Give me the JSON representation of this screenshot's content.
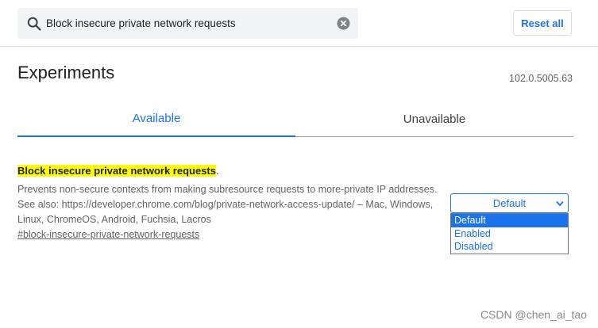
{
  "search": {
    "value": "Block insecure private network requests",
    "icon": "search-icon",
    "clear_icon": "clear-icon"
  },
  "header": {
    "reset_label": "Reset all"
  },
  "page": {
    "title": "Experiments",
    "version": "102.0.5005.63"
  },
  "tabs": [
    {
      "label": "Available",
      "active": true
    },
    {
      "label": "Unavailable",
      "active": false
    }
  ],
  "experiment": {
    "title_highlight": "Block insecure private network requests",
    "title_suffix": ".",
    "description": "Prevents non-secure contexts from making subresource requests to more-private IP addresses. See also: https://developer.chrome.com/blog/private-network-access-update/ – Mac, Windows, Linux, ChromeOS, Android, Fuchsia, Lacros",
    "link": "#block-insecure-private-network-requests",
    "select_value": "Default",
    "options": [
      "Default",
      "Enabled",
      "Disabled"
    ],
    "selected_index": 0
  },
  "watermark": "CSDN @chen_ai_tao",
  "colors": {
    "accent": "#1a73e8",
    "highlight": "#ffff00",
    "text_secondary": "#5f6368"
  }
}
